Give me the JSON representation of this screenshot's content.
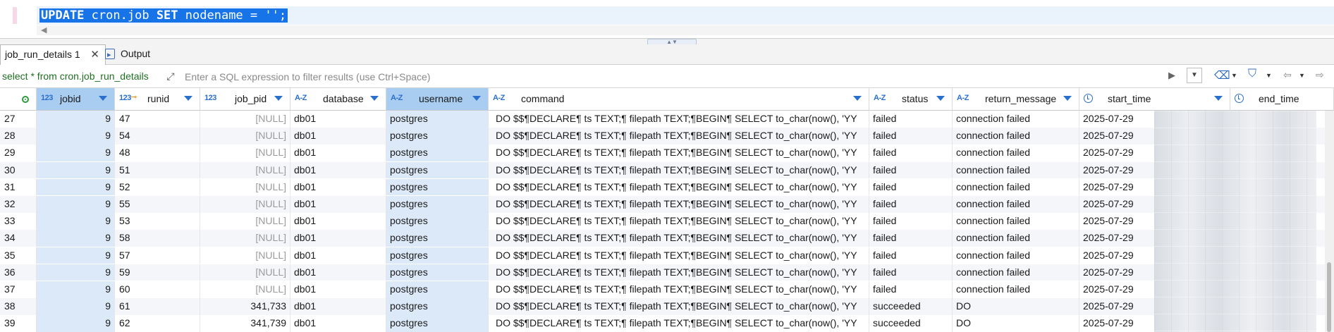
{
  "editor": {
    "sql_kw1": "UPDATE",
    "sql_table": "cron.job",
    "sql_kw2": "SET",
    "sql_rest": "nodename = '';"
  },
  "tabs": [
    {
      "label": "job_run_details 1",
      "active": true
    },
    {
      "label": "Output",
      "active": false
    }
  ],
  "filter": {
    "query_text": "select * from cron.job_run_details",
    "placeholder": "Enter a SQL expression to filter results (use Ctrl+Space)"
  },
  "columns": [
    {
      "type": "123",
      "name": "jobid",
      "selected": true
    },
    {
      "type": "123",
      "name": "runid",
      "key": true,
      "selected": false
    },
    {
      "type": "123",
      "name": "job_pid",
      "selected": false
    },
    {
      "type": "A-Z",
      "name": "database",
      "selected": false
    },
    {
      "type": "A-Z",
      "name": "username",
      "selected": true
    },
    {
      "type": "A-Z",
      "name": "command",
      "selected": false
    },
    {
      "type": "A-Z",
      "name": "status",
      "selected": false
    },
    {
      "type": "A-Z",
      "name": "return_message",
      "selected": false
    },
    {
      "type": "clock",
      "name": "start_time",
      "selected": false
    },
    {
      "type": "clock",
      "name": "end_time",
      "selected": false
    }
  ],
  "command_text": "DO $$¶DECLARE¶    ts TEXT;¶    filepath TEXT;¶BEGIN¶    SELECT to_char(now(), 'YY",
  "rows": [
    {
      "n": "27",
      "jobid": "9",
      "runid": "47",
      "job_pid": "[NULL]",
      "database": "db01",
      "username": "postgres",
      "status": "failed",
      "return_message": "connection failed",
      "start_time": "2025-07-29"
    },
    {
      "n": "28",
      "jobid": "9",
      "runid": "54",
      "job_pid": "[NULL]",
      "database": "db01",
      "username": "postgres",
      "status": "failed",
      "return_message": "connection failed",
      "start_time": "2025-07-29"
    },
    {
      "n": "29",
      "jobid": "9",
      "runid": "48",
      "job_pid": "[NULL]",
      "database": "db01",
      "username": "postgres",
      "status": "failed",
      "return_message": "connection failed",
      "start_time": "2025-07-29"
    },
    {
      "n": "30",
      "jobid": "9",
      "runid": "51",
      "job_pid": "[NULL]",
      "database": "db01",
      "username": "postgres",
      "status": "failed",
      "return_message": "connection failed",
      "start_time": "2025-07-29"
    },
    {
      "n": "31",
      "jobid": "9",
      "runid": "52",
      "job_pid": "[NULL]",
      "database": "db01",
      "username": "postgres",
      "status": "failed",
      "return_message": "connection failed",
      "start_time": "2025-07-29"
    },
    {
      "n": "32",
      "jobid": "9",
      "runid": "55",
      "job_pid": "[NULL]",
      "database": "db01",
      "username": "postgres",
      "status": "failed",
      "return_message": "connection failed",
      "start_time": "2025-07-29"
    },
    {
      "n": "33",
      "jobid": "9",
      "runid": "53",
      "job_pid": "[NULL]",
      "database": "db01",
      "username": "postgres",
      "status": "failed",
      "return_message": "connection failed",
      "start_time": "2025-07-29"
    },
    {
      "n": "34",
      "jobid": "9",
      "runid": "58",
      "job_pid": "[NULL]",
      "database": "db01",
      "username": "postgres",
      "status": "failed",
      "return_message": "connection failed",
      "start_time": "2025-07-29"
    },
    {
      "n": "35",
      "jobid": "9",
      "runid": "57",
      "job_pid": "[NULL]",
      "database": "db01",
      "username": "postgres",
      "status": "failed",
      "return_message": "connection failed",
      "start_time": "2025-07-29"
    },
    {
      "n": "36",
      "jobid": "9",
      "runid": "59",
      "job_pid": "[NULL]",
      "database": "db01",
      "username": "postgres",
      "status": "failed",
      "return_message": "connection failed",
      "start_time": "2025-07-29"
    },
    {
      "n": "37",
      "jobid": "9",
      "runid": "60",
      "job_pid": "[NULL]",
      "database": "db01",
      "username": "postgres",
      "status": "failed",
      "return_message": "connection failed",
      "start_time": "2025-07-29"
    },
    {
      "n": "38",
      "jobid": "9",
      "runid": "61",
      "job_pid": "341,733",
      "database": "db01",
      "username": "postgres",
      "status": "succeeded",
      "return_message": "DO",
      "start_time": "2025-07-29"
    },
    {
      "n": "39",
      "jobid": "9",
      "runid": "62",
      "job_pid": "341,739",
      "database": "db01",
      "username": "postgres",
      "status": "succeeded",
      "return_message": "DO",
      "start_time": "2025-07-29"
    }
  ],
  "colors": {
    "selection": "#1673e8",
    "selected_column_header": "#a9ccf1",
    "selected_column_cell": "#dce9f8",
    "null_text": "#9b9b9b",
    "query_green": "#1f6f22"
  }
}
